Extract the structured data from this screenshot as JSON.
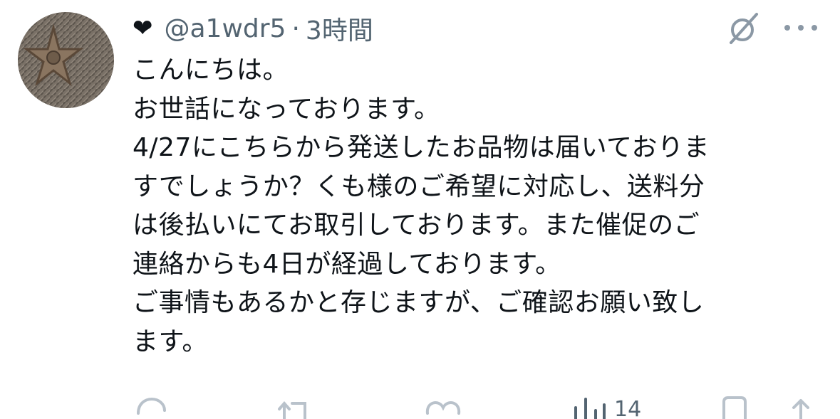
{
  "header": {
    "heart": "❤",
    "handle": "@a1wdr5",
    "separator": "·",
    "time": "3時間"
  },
  "body_lines": [
    "こんにちは。",
    "お世話になっております。",
    "4/27にこちらから発送したお品物は届いておりま",
    "すでしょうか？くも様のご希望に対応し、送料分",
    "は後払いにてお取引しております。また催促のご",
    "連絡からも4日が経過しております。",
    "ご事情もあるかと存じますが、ご確認お願い致し",
    "ます。"
  ],
  "actions": {
    "views_count": "14"
  },
  "icons": {
    "avatar": "star-avatar",
    "grok": "grok-icon",
    "more": "more-icon",
    "reply": "reply-icon",
    "retweet": "retweet-icon",
    "like": "like-icon",
    "views": "views-icon",
    "bookmark": "bookmark-icon",
    "share": "share-icon"
  },
  "colors": {
    "text": "#0f1419",
    "secondary": "#536471",
    "icon": "#b9c2cb"
  }
}
